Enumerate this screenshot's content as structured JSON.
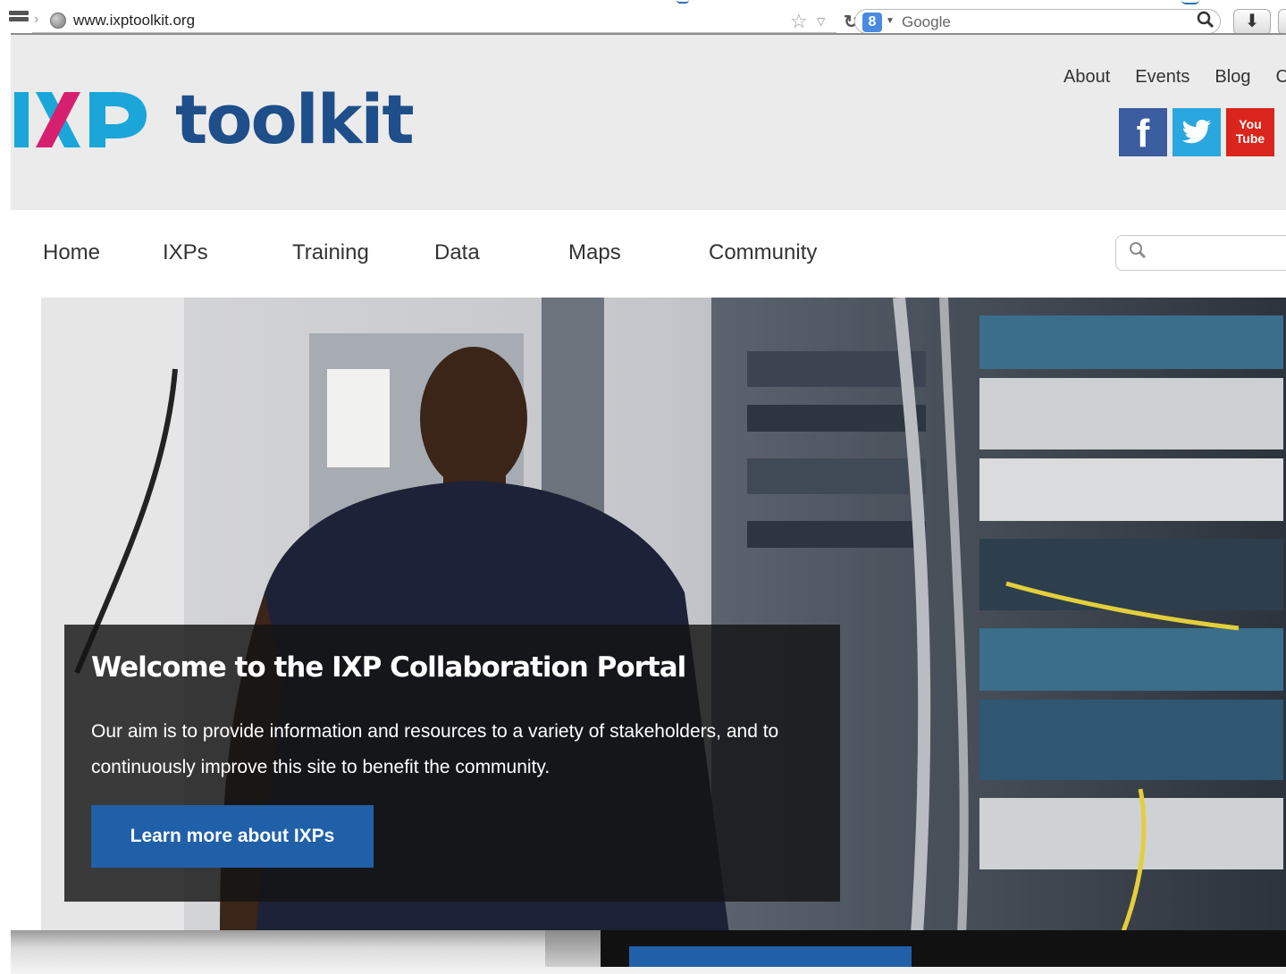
{
  "browser": {
    "url": "www.ixptoolkit.org",
    "search_engine": "Google",
    "search_engine_badge": "8"
  },
  "logo": {
    "mark": "IXP",
    "wordmark": "toolkit",
    "colors": {
      "teal": "#1aa6d8",
      "magenta": "#d6206f",
      "navy": "#1f4f8a"
    }
  },
  "header": {
    "top_links": [
      "About",
      "Events",
      "Blog",
      "C"
    ],
    "social": [
      {
        "name": "facebook-icon",
        "glyph": "f"
      },
      {
        "name": "twitter-icon",
        "glyph": "🐦"
      },
      {
        "name": "youtube-icon",
        "glyph": "You Tube"
      }
    ]
  },
  "nav": {
    "items": [
      "Home",
      "IXPs",
      "Training",
      "Data",
      "Maps",
      "Community"
    ]
  },
  "hero": {
    "title": "Welcome to the IXP Collaboration Portal",
    "body": "Our aim is to provide information and resources to a variety of stakeholders, and to continuously improve this site to benefit the community.",
    "cta_label": "Learn more about IXPs"
  },
  "colors": {
    "header_bg": "#ebebeb",
    "button_blue": "#2060a8"
  }
}
